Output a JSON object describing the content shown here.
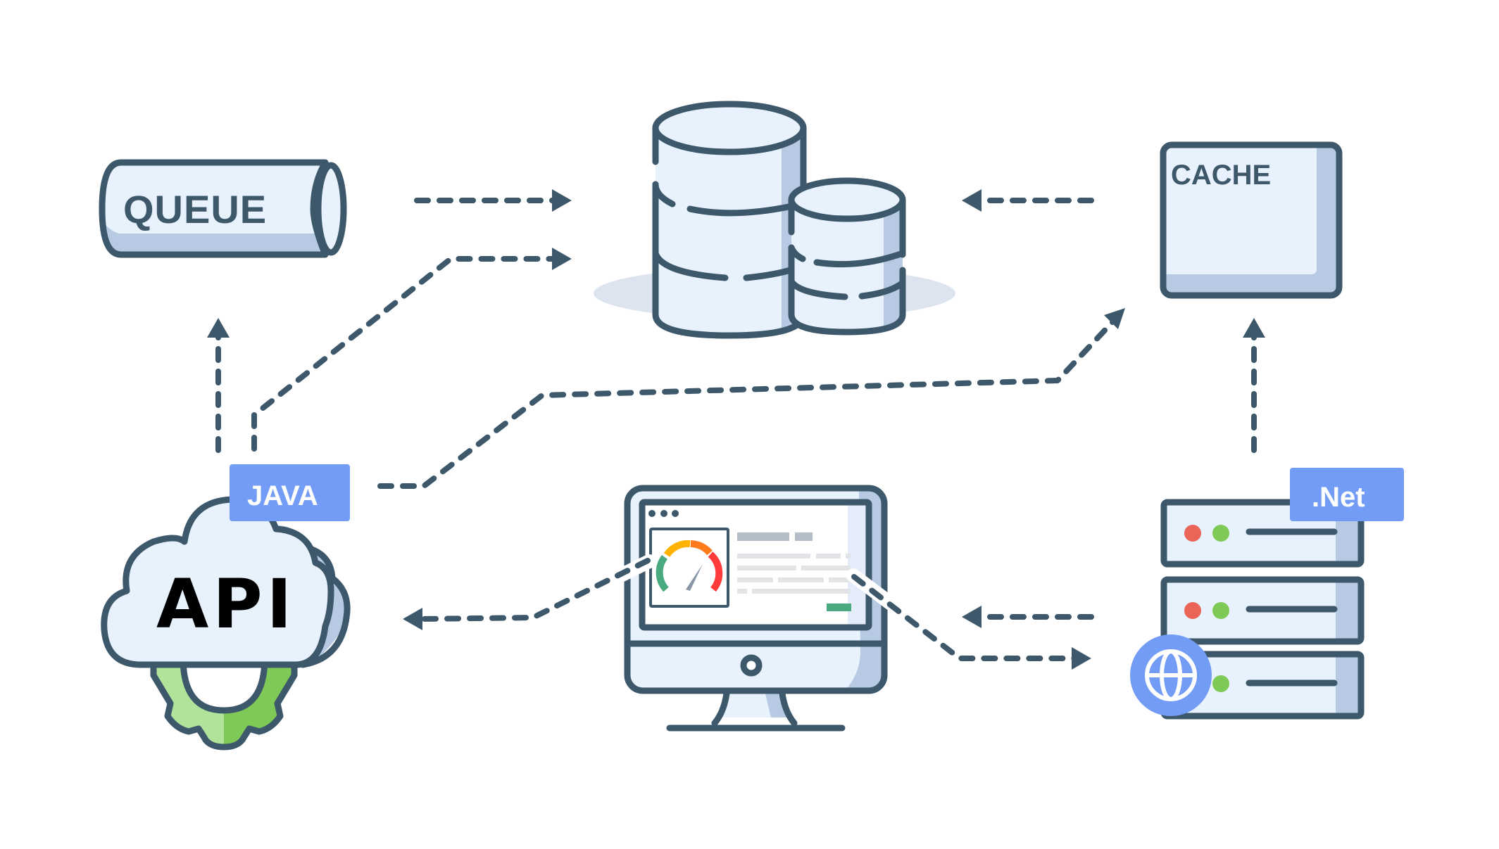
{
  "diagram": {
    "title": "",
    "nodes": {
      "queue": {
        "label": "QUEUE"
      },
      "database": {
        "label": ""
      },
      "cache": {
        "label": "CACHE"
      },
      "api": {
        "label": "API",
        "badge": "JAVA"
      },
      "monitor": {
        "label": ""
      },
      "server": {
        "label": "",
        "badge": ".Net"
      }
    },
    "edges": [
      {
        "from": "queue",
        "to": "database"
      },
      {
        "from": "api",
        "to": "database"
      },
      {
        "from": "api",
        "to": "queue"
      },
      {
        "from": "api",
        "to": "cache"
      },
      {
        "from": "cache",
        "to": "database"
      },
      {
        "from": "server",
        "to": "cache"
      },
      {
        "from": "monitor",
        "to": "api"
      },
      {
        "from": "server",
        "to": "monitor"
      },
      {
        "from": "monitor",
        "to": "server"
      }
    ],
    "colors": {
      "stroke": "#3d576b",
      "fill_light": "#e8f2fc",
      "fill_shadow": "#b7c9e3",
      "badge": "#729cf5",
      "gear_light": "#b1e39b",
      "gear_dark": "#7fca57",
      "led_red": "#ea6458",
      "led_green": "#7fca57",
      "gauge_green": "#4aaa7f",
      "gauge_yellow": "#ffb300",
      "gauge_orange": "#ff7a1a",
      "gauge_red": "#ff3b3b"
    }
  }
}
